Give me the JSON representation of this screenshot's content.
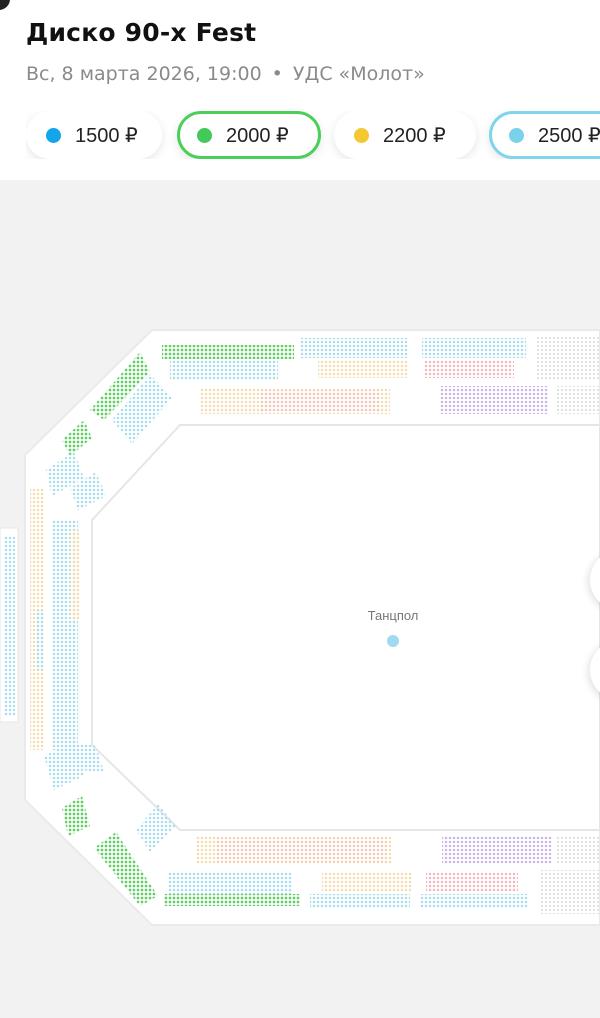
{
  "event": {
    "title": "Диско 90-х Fest",
    "date": "Вс, 8 марта 2026, 19:00",
    "separator": "•",
    "venue": "УДС «Молот»"
  },
  "price_chips": [
    {
      "label": "1500 ₽",
      "color": "#14a4e8",
      "selected": false
    },
    {
      "label": "2000 ₽",
      "color": "#43c957",
      "selected": true
    },
    {
      "label": "2200 ₽",
      "color": "#f3c830",
      "selected": false
    },
    {
      "label": "2500 ₽",
      "color": "#79d2ea",
      "selected": true
    }
  ],
  "hall_map": {
    "dance_floor_label": "Танцпол",
    "dance_floor_color": "#9fd9f2",
    "zone_colors": {
      "light_blue": "#a9ddee",
      "green": "#5fcf63",
      "beige": "#f3ddb0",
      "pink": "#f2b7c1",
      "lavender": "#c9b7e6",
      "light_gray": "#dedede"
    }
  }
}
